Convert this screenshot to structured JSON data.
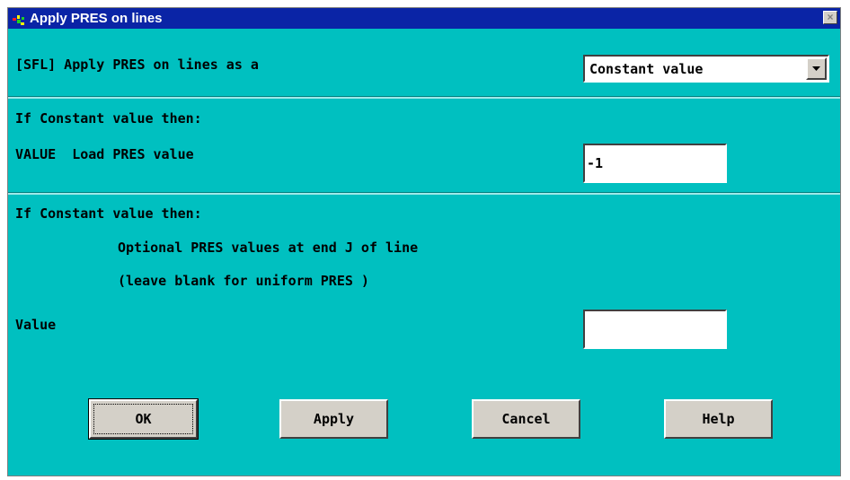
{
  "window": {
    "title": "Apply PRES on lines",
    "close_label": "×"
  },
  "sfl_section": {
    "label": "[SFL] Apply PRES on lines as a",
    "select_value": "Constant value"
  },
  "value_section": {
    "condition": "If Constant value then:",
    "field_label": "VALUE  Load PRES value",
    "field_value": "-1"
  },
  "optional_section": {
    "condition": "If Constant value then:",
    "line1": "Optional PRES values at end J of line",
    "line2": "(leave blank for uniform PRES )",
    "field_label": "Value",
    "field_value": ""
  },
  "buttons": {
    "ok": "OK",
    "apply": "Apply",
    "cancel": "Cancel",
    "help": "Help"
  },
  "colors": {
    "dialog_bg": "#00c0c0",
    "titlebar": "#0a24a6",
    "button_face": "#d4d0c8"
  },
  "icons": {
    "app": "ansys-app-icon",
    "close": "close-icon",
    "dropdown": "chevron-down-icon"
  }
}
